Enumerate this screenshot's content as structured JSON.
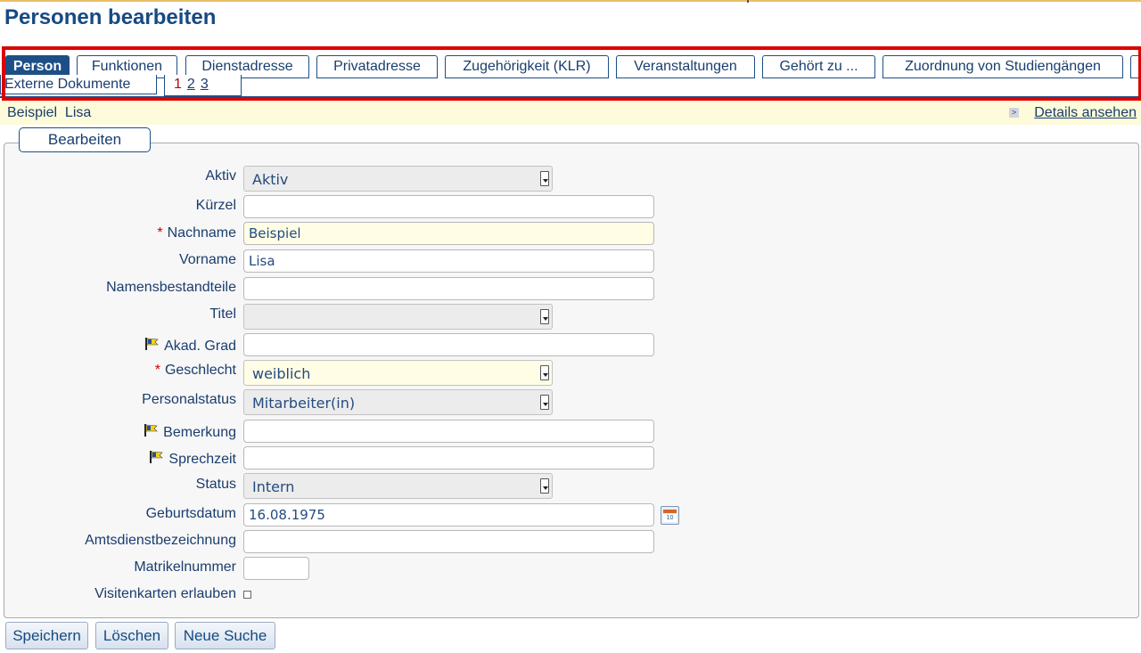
{
  "page": {
    "title": "Personen bearbeiten"
  },
  "tabs": [
    {
      "label": "Person",
      "active": true
    },
    {
      "label": "Funktionen"
    },
    {
      "label": "Dienstadresse"
    },
    {
      "label": "Privatadresse"
    },
    {
      "label": "Zugehörigkeit (KLR)"
    },
    {
      "label": "Veranstaltungen"
    },
    {
      "label": "Gehört zu ..."
    },
    {
      "label": "Zuordnung von Studiengängen"
    },
    {
      "label": "Externe Dokumente"
    }
  ],
  "pager": {
    "current": "1",
    "pages": [
      "2",
      "3"
    ]
  },
  "infobar": {
    "name": "Beispiel  Lisa",
    "details_link": "Details ansehen",
    "arrow_glyph": ">"
  },
  "form": {
    "legend": "Bearbeiten",
    "fields": {
      "aktiv": {
        "label": "Aktiv",
        "value": "Aktiv"
      },
      "kuerzel": {
        "label": "Kürzel",
        "value": ""
      },
      "nachname": {
        "label": "Nachname",
        "value": "Beispiel",
        "required": "*"
      },
      "vorname": {
        "label": "Vorname",
        "value": "Lisa"
      },
      "namensbestandteile": {
        "label": "Namensbestandteile",
        "value": ""
      },
      "titel": {
        "label": "Titel",
        "value": ""
      },
      "akad_grad": {
        "label": "Akad. Grad",
        "value": ""
      },
      "geschlecht": {
        "label": "Geschlecht",
        "value": "weiblich",
        "required": "*"
      },
      "personalstatus": {
        "label": "Personalstatus",
        "value": "Mitarbeiter(in)"
      },
      "bemerkung": {
        "label": "Bemerkung",
        "value": ""
      },
      "sprechzeit": {
        "label": "Sprechzeit",
        "value": ""
      },
      "status": {
        "label": "Status",
        "value": "Intern"
      },
      "geburtsdatum": {
        "label": "Geburtsdatum",
        "value": "16.08.1975",
        "calendar_day": "10"
      },
      "amtsdienstbezeichnung": {
        "label": "Amtsdienstbezeichnung",
        "value": ""
      },
      "matrikelnummer": {
        "label": "Matrikelnummer",
        "value": ""
      },
      "visitenkarten": {
        "label": "Visitenkarten erlauben",
        "checked": false
      }
    }
  },
  "buttons": {
    "save": "Speichern",
    "delete": "Löschen",
    "new_search": "Neue Suche"
  },
  "colors": {
    "accent": "#1d4f86",
    "highlight_red": "#dd0000",
    "required_bg": "#fffde5",
    "infobar_bg": "#fdfbd9"
  }
}
